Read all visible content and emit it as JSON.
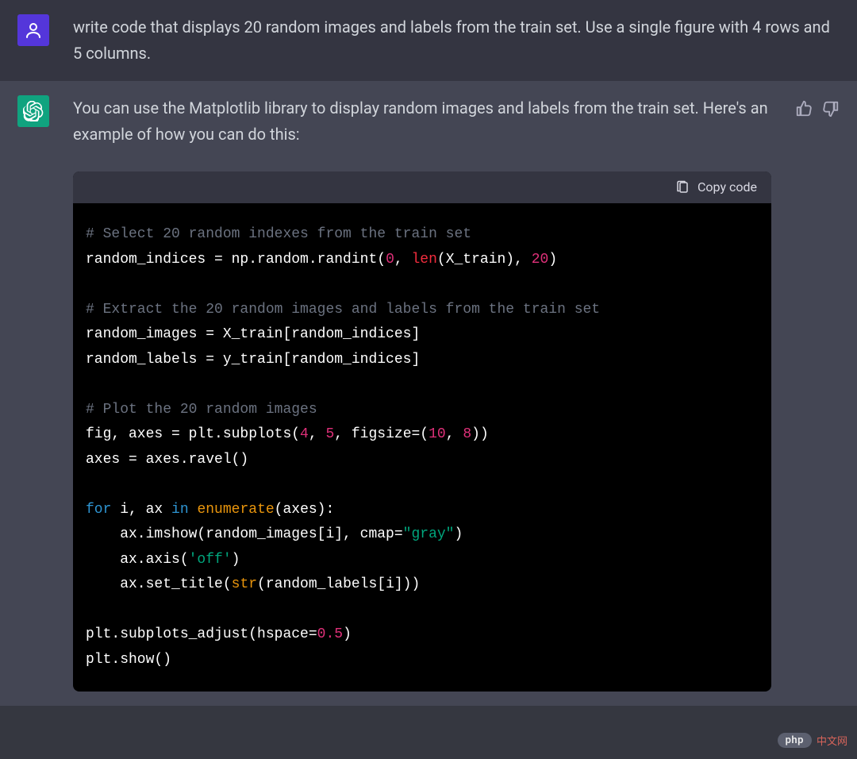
{
  "user": {
    "prompt": "write code that displays 20 random images and labels from the train set. Use a single figure with 4 rows and 5 columns."
  },
  "assistant": {
    "intro": "You can use the Matplotlib library to display random images and labels from the train set. Here's an example of how you can do this:",
    "copy_label": "Copy code",
    "code": {
      "c1": "# Select 20 random indexes from the train set",
      "l2a": "random_indices = np.random.randint(",
      "l2b": "0",
      "l2c": ", ",
      "l2d": "len",
      "l2e": "(X_train), ",
      "l2f": "20",
      "l2g": ")",
      "c2": "# Extract the 20 random images and labels from the train set",
      "l5": "random_images = X_train[random_indices]",
      "l6": "random_labels = y_train[random_indices]",
      "c3": "# Plot the 20 random images",
      "l9a": "fig, axes = plt.subplots(",
      "l9b": "4",
      "l9c": ", ",
      "l9d": "5",
      "l9e": ", figsize=(",
      "l9f": "10",
      "l9g": ", ",
      "l9h": "8",
      "l9i": "))",
      "l10": "axes = axes.ravel()",
      "l12a": "for",
      "l12b": " i, ax ",
      "l12c": "in",
      "l12d": " ",
      "l12e": "enumerate",
      "l12f": "(axes):",
      "l13a": "    ax.imshow(random_images[i], cmap=",
      "l13b": "\"gray\"",
      "l13c": ")",
      "l14a": "    ax.axis(",
      "l14b": "'off'",
      "l14c": ")",
      "l15a": "    ax.set_title(",
      "l15b": "str",
      "l15c": "(random_labels[i]))",
      "l17a": "plt.subplots_adjust(hspace=",
      "l17b": "0.5",
      "l17c": ")",
      "l18": "plt.show()"
    }
  },
  "watermark": {
    "badge": "php",
    "text": "中文网"
  }
}
